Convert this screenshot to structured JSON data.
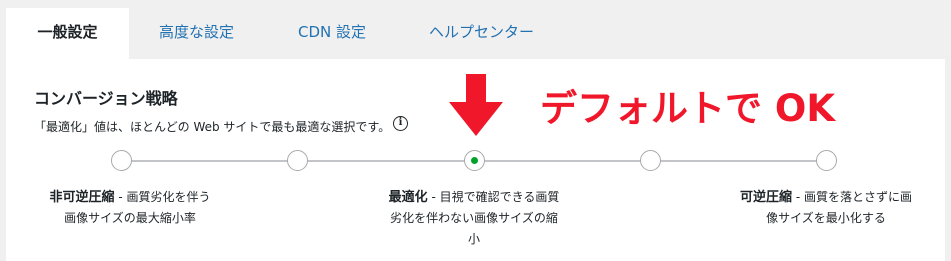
{
  "tabs": [
    {
      "label": "一般設定",
      "active": true
    },
    {
      "label": "高度な設定",
      "active": false
    },
    {
      "label": "CDN 設定",
      "active": false
    },
    {
      "label": "ヘルプセンター",
      "active": false
    }
  ],
  "section": {
    "title": "コンバージョン戦略",
    "description": "「最適化」値は、ほとんどの Web サイトで最も最適な選択です。",
    "info_icon": "info-icon"
  },
  "annotation": {
    "text": "デフォルトで OK",
    "color": "#f0172b",
    "arrow_icon": "down-arrow-icon"
  },
  "slider": {
    "positions": 5,
    "selected_index": 2,
    "selected_color": "#00a32a"
  },
  "options": [
    {
      "name": "非可逆圧縮",
      "line1": " - 画質劣化を伴う",
      "line2": "画像サイズの最大縮小率"
    },
    {
      "name": "最適化",
      "line1": " - 目視で確認できる画質",
      "line2": "劣化を伴わない画像サイズの縮",
      "line3": "小"
    },
    {
      "name": "可逆圧縮",
      "line1": " - 画質を落とさずに画",
      "line2": "像サイズを最小化する"
    }
  ]
}
